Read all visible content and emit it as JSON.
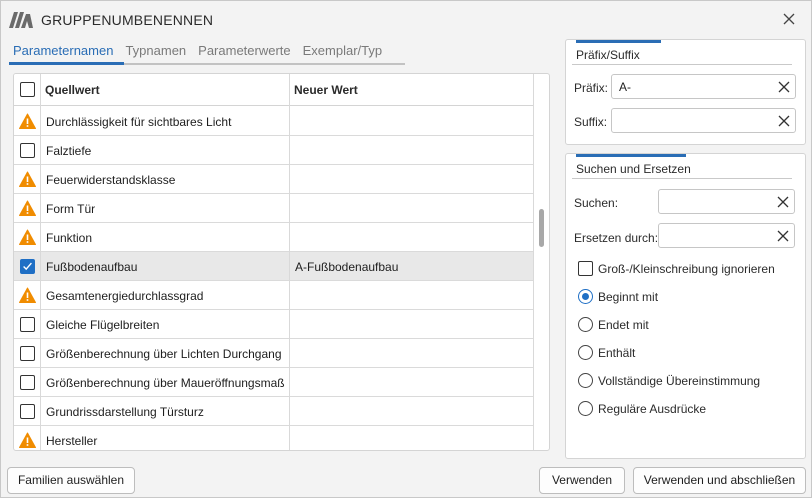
{
  "window": {
    "title": "GRUPPENUMBENENNEN"
  },
  "tabs": [
    {
      "label": "Parameternamen",
      "active": true
    },
    {
      "label": "Typnamen",
      "active": false
    },
    {
      "label": "Parameterwerte",
      "active": false
    },
    {
      "label": "Exemplar/Typ",
      "active": false
    }
  ],
  "grid": {
    "columns": {
      "source": "Quellwert",
      "target": "Neuer Wert"
    },
    "rows": [
      {
        "name": "Durchlässigkeit für sichtbares Licht",
        "new_value": "",
        "state": "warning"
      },
      {
        "name": "Falztiefe",
        "new_value": "",
        "state": "unchecked"
      },
      {
        "name": "Feuerwiderstandsklasse",
        "new_value": "",
        "state": "warning"
      },
      {
        "name": "Form Tür",
        "new_value": "",
        "state": "warning"
      },
      {
        "name": "Funktion",
        "new_value": "",
        "state": "warning"
      },
      {
        "name": "Fußbodenaufbau",
        "new_value": "A-Fußbodenaufbau",
        "state": "checked"
      },
      {
        "name": "Gesamtenergiedurchlassgrad",
        "new_value": "",
        "state": "warning"
      },
      {
        "name": "Gleiche Flügelbreiten",
        "new_value": "",
        "state": "unchecked"
      },
      {
        "name": "Größenberechnung über Lichten Durchgang",
        "new_value": "",
        "state": "unchecked"
      },
      {
        "name": "Größenberechnung über Maueröffnungsmaß",
        "new_value": "",
        "state": "unchecked"
      },
      {
        "name": "Grundrissdarstellung Türsturz",
        "new_value": "",
        "state": "unchecked"
      },
      {
        "name": "Hersteller",
        "new_value": "",
        "state": "warning"
      }
    ]
  },
  "prefix_suffix": {
    "title": "Präfix/Suffix",
    "prefix_label": "Präfix:",
    "prefix_value": "A-",
    "suffix_label": "Suffix:",
    "suffix_value": ""
  },
  "search_replace": {
    "title": "Suchen und Ersetzen",
    "search_label": "Suchen:",
    "search_value": "",
    "replace_label": "Ersetzen durch:",
    "replace_value": "",
    "ignore_case_label": "Groß-/Kleinschreibung ignorieren",
    "ignore_case_checked": false,
    "modes": [
      {
        "label": "Beginnt mit",
        "selected": true
      },
      {
        "label": "Endet mit",
        "selected": false
      },
      {
        "label": "Enthält",
        "selected": false
      },
      {
        "label": "Vollständige Übereinstimmung",
        "selected": false
      },
      {
        "label": "Reguläre Ausdrücke",
        "selected": false
      }
    ]
  },
  "buttons": {
    "select_families": "Familien auswählen",
    "apply": "Verwenden",
    "apply_close": "Verwenden und abschließen"
  },
  "colors": {
    "accent": "#2a6db5",
    "warning": "#f08c00",
    "check": "#1f6fc5"
  },
  "icons": {
    "logo": "app-logo-icon",
    "close": "close-icon",
    "warning": "warning-icon",
    "clear": "clear-x-icon"
  }
}
